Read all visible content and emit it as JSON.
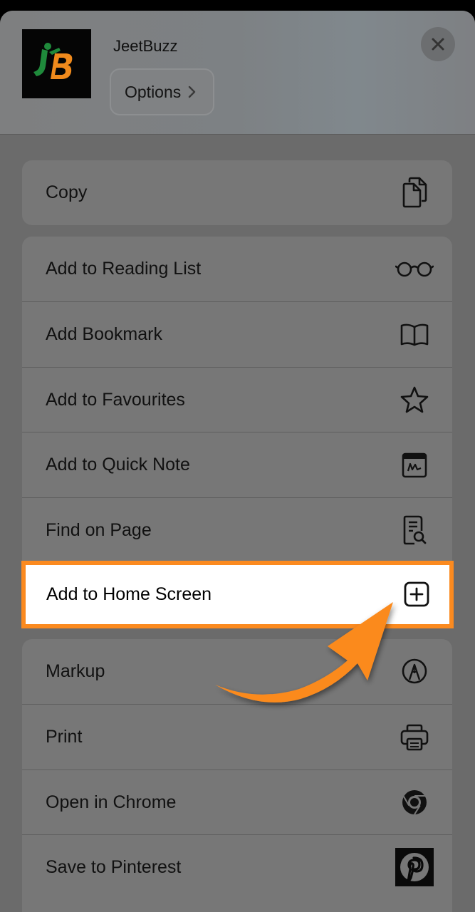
{
  "header": {
    "app_name": "JeetBuzz",
    "options_label": "Options",
    "app_icon": "jeetbuzz-logo"
  },
  "groups": [
    {
      "items": [
        {
          "label": "Copy",
          "icon": "copy-icon"
        }
      ]
    },
    {
      "items": [
        {
          "label": "Add to Reading List",
          "icon": "glasses-icon"
        },
        {
          "label": "Add Bookmark",
          "icon": "book-icon"
        },
        {
          "label": "Add to Favourites",
          "icon": "star-icon"
        },
        {
          "label": "Add to Quick Note",
          "icon": "quick-note-icon"
        },
        {
          "label": "Find on Page",
          "icon": "find-in-page-icon"
        },
        {
          "label": "Add to Home Screen",
          "icon": "plus-square-icon",
          "highlighted": true
        }
      ]
    },
    {
      "items": [
        {
          "label": "Markup",
          "icon": "markup-pen-icon"
        },
        {
          "label": "Print",
          "icon": "printer-icon"
        },
        {
          "label": "Open in Chrome",
          "icon": "chrome-icon"
        },
        {
          "label": "Save to Pinterest",
          "icon": "pinterest-icon"
        }
      ]
    }
  ],
  "annotation": {
    "arrow_icon": "orange-curved-arrow",
    "highlight_color": "#fb8a1f"
  },
  "colors": {
    "sheet_bg": "#6b6b6b",
    "row_bg": "#777777",
    "accent": "#fb8a1f"
  }
}
